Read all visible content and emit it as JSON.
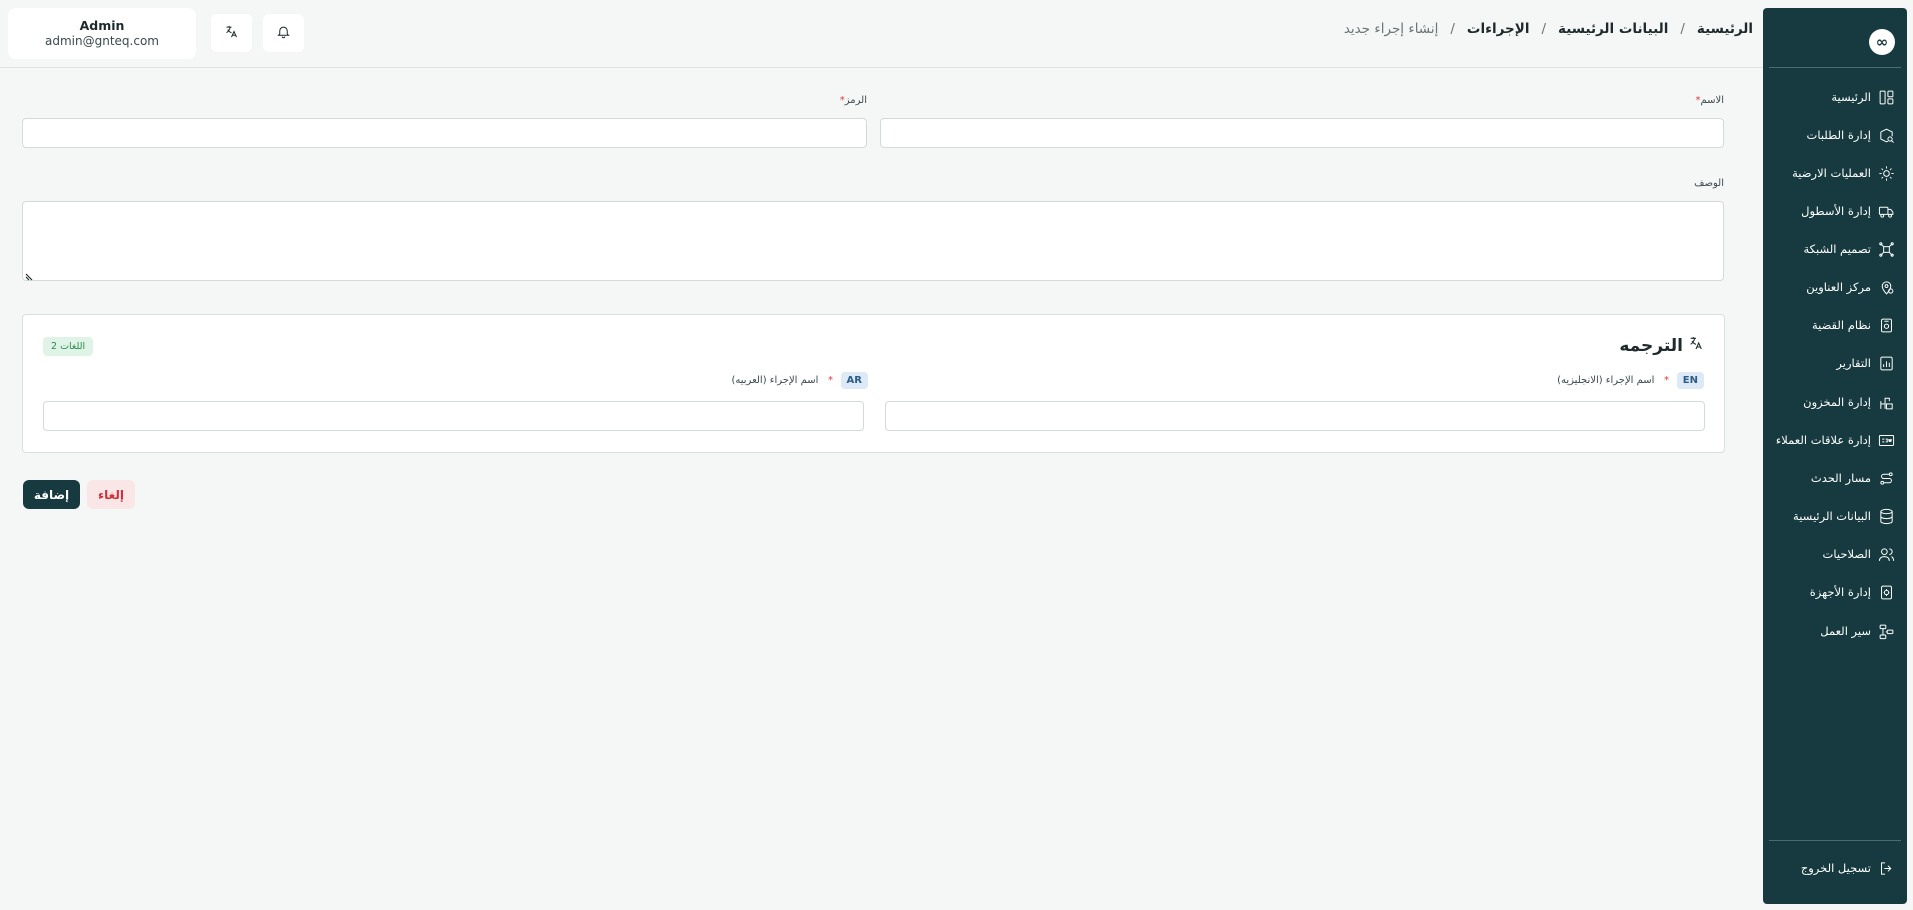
{
  "sidebar": {
    "logo_glyph": "∞",
    "items": [
      {
        "label": "الرئيسية",
        "icon": "layout-dashboard-icon"
      },
      {
        "label": "إدارة الطلبات",
        "icon": "package-search-icon"
      },
      {
        "label": "العمليات الارضية",
        "icon": "sun-radar-icon"
      },
      {
        "label": "إدارة الأسطول",
        "icon": "truck-icon"
      },
      {
        "label": "تصميم الشبكة",
        "icon": "network-grid-icon"
      },
      {
        "label": "مركز العناوين",
        "icon": "map-pin-icon"
      },
      {
        "label": "نظام القضية",
        "icon": "case-file-icon"
      },
      {
        "label": "التقارير",
        "icon": "report-chart-icon"
      },
      {
        "label": "إدارة المخزون",
        "icon": "warehouse-icon"
      },
      {
        "label": "إدارة علاقات العملاء",
        "icon": "crm-icon"
      },
      {
        "label": "مسار الحدث",
        "icon": "route-icon"
      },
      {
        "label": "البيانات الرئيسية",
        "icon": "database-icon"
      },
      {
        "label": "الصلاحيات",
        "icon": "users-icon"
      },
      {
        "label": "إدارة الأجهزة",
        "icon": "device-settings-icon"
      },
      {
        "label": "سير العمل",
        "icon": "workflow-icon"
      }
    ],
    "logout_label": "تسجيل الخروج"
  },
  "header": {
    "breadcrumb": [
      "الرئيسية",
      "البيانات الرئيسية",
      "الإجراءات"
    ],
    "breadcrumb_current": "إنشاء إجراء جديد",
    "breadcrumb_separator": "/",
    "user": {
      "name": "Admin",
      "email": "admin@gnteq.com"
    }
  },
  "form": {
    "name_label": "الاسم",
    "code_label": "الرمز",
    "description_label": "الوصف",
    "required_mark": "*",
    "name_value": "",
    "code_value": "",
    "description_value": ""
  },
  "translation": {
    "title": "الترجمه",
    "languages_count": "2 اللغات",
    "en_badge": "EN",
    "en_label": "اسم الإجراء (الانجليزيه)",
    "ar_badge": "AR",
    "ar_label": "اسم الإجراء (العربيه)",
    "en_value": "",
    "ar_value": ""
  },
  "actions": {
    "add_label": "إضافة",
    "cancel_label": "إلغاء"
  },
  "colors": {
    "sidebar_bg": "#163a3f",
    "primary": "#163a3f",
    "danger": "#d0303a",
    "required": "#e0383e",
    "badge_green": "#2f8a4f"
  }
}
